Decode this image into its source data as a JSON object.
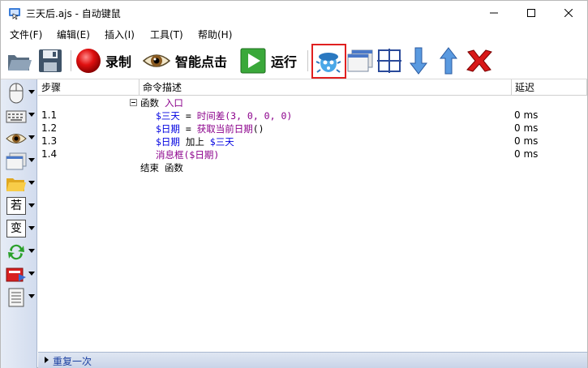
{
  "window": {
    "title": "三天后.ajs - 自动键鼠"
  },
  "menu": [
    {
      "label": "文件(F)"
    },
    {
      "label": "编辑(E)"
    },
    {
      "label": "插入(I)"
    },
    {
      "label": "工具(T)"
    },
    {
      "label": "帮助(H)"
    }
  ],
  "toolbar": {
    "record_label": "录制",
    "smart_click_label": "智能点击",
    "run_label": "运行"
  },
  "table": {
    "columns": [
      "步骤",
      "命令描述",
      "延迟"
    ],
    "function_header": {
      "keyword": "函数",
      "name": "入口"
    },
    "rows": [
      {
        "step": "1.1",
        "var": "$三天",
        "op": " = ",
        "fn": "时间差",
        "args": "(3, 0, 0, 0)",
        "delay": "0 ms"
      },
      {
        "step": "1.2",
        "var": "$日期",
        "op": " = ",
        "fn": "获取当前日期",
        "args": "()",
        "delay": "0 ms"
      },
      {
        "step": "1.3",
        "var": "$日期",
        "op": " 加上 ",
        "fn": "",
        "args": "$三天",
        "delay": "0 ms"
      },
      {
        "step": "1.4",
        "var": "",
        "op": "",
        "fn": "消息框",
        "args": "($日期)",
        "delay": "0 ms"
      }
    ],
    "function_end": "结束 函数"
  },
  "bottom": {
    "label": "重复一次"
  },
  "colors": {
    "highlight": "#e02020",
    "variable": "#0000e0",
    "function": "#8b008b",
    "palette_bg": "#dce4f2"
  }
}
